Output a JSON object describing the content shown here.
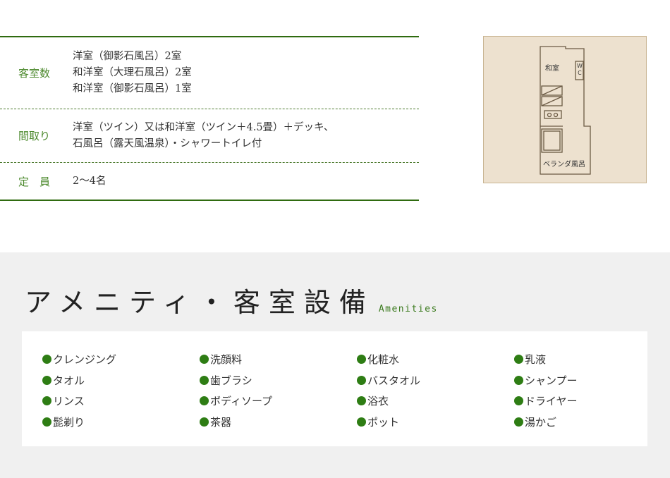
{
  "room_info": {
    "rows": [
      {
        "label": "客室数",
        "values": [
          "洋室（御影石風呂）2室",
          "和洋室（大理石風呂）2室",
          "和洋室（御影石風呂）1室"
        ]
      },
      {
        "label": "間取り",
        "values": [
          "洋室（ツイン）又は和洋室（ツイン＋4.5畳）＋デッキ、",
          "石風呂（露天風温泉）・シャワートイレ付"
        ]
      },
      {
        "label": "定　員",
        "values": [
          "2～4名"
        ]
      }
    ]
  },
  "floorplan": {
    "washitsu": "和室",
    "wc_top": "W",
    "wc_bottom": "C",
    "veranda_bath": "ベランダ風呂"
  },
  "amenities": {
    "title": "アメニティ・客室設備",
    "title_en": "Amenities",
    "items": [
      "クレンジング",
      "洗顔料",
      "化粧水",
      "乳液",
      "タオル",
      "歯ブラシ",
      "バスタオル",
      "シャンプー",
      "リンス",
      "ボディソープ",
      "浴衣",
      "ドライヤー",
      "髭剃り",
      "茶器",
      "ポット",
      "湯かご"
    ]
  },
  "colors": {
    "accent_green": "#2f6b10",
    "label_green": "#4d8a2e",
    "bullet_green": "#2e7d14",
    "plan_bg": "#ede1cf",
    "section_bg": "#f0f0f0"
  }
}
